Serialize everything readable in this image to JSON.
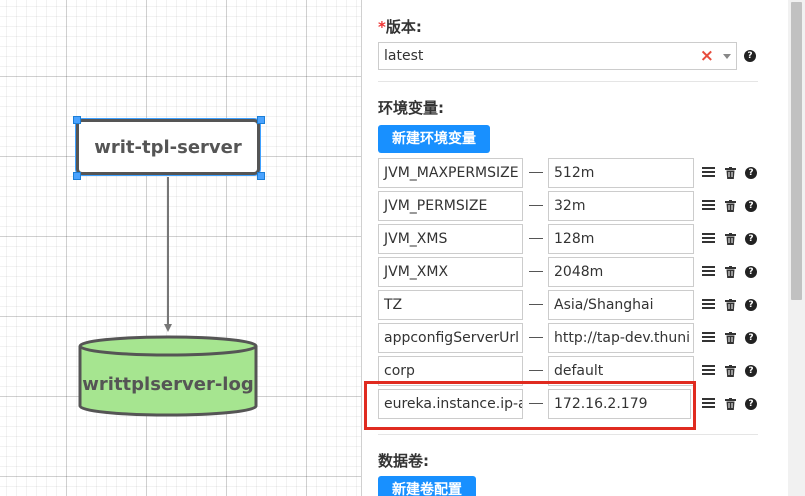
{
  "canvas": {
    "service_node": "writ-tpl-server",
    "db_node": "writtplserver-log"
  },
  "panel": {
    "version": {
      "required_mark": "*",
      "label": "版本:",
      "value": "latest"
    },
    "env": {
      "label": "环境变量:",
      "new_button": "新建环境变量",
      "rows": [
        {
          "key": "JVM_MAXPERMSIZE",
          "value": "512m"
        },
        {
          "key": "JVM_PERMSIZE",
          "value": "32m"
        },
        {
          "key": "JVM_XMS",
          "value": "128m"
        },
        {
          "key": "JVM_XMX",
          "value": "2048m"
        },
        {
          "key": "TZ",
          "value": "Asia/Shanghai"
        },
        {
          "key": "appconfigServerUrl",
          "value": "http://tap-dev.thuni"
        },
        {
          "key": "corp",
          "value": "default"
        },
        {
          "key": "eureka.instance.ip-a",
          "value": "172.16.2.179"
        }
      ]
    },
    "volumes": {
      "label": "数据卷:",
      "new_button": "新建卷配置"
    }
  },
  "colors": {
    "accent": "#1890ff",
    "highlight": "#e02b20",
    "db_fill": "#a6e590",
    "selection": "#3ea0ff"
  }
}
